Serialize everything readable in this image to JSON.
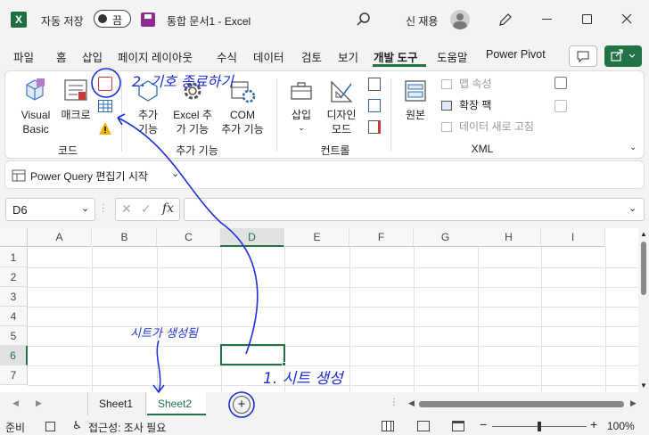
{
  "titlebar": {
    "autosave_label": "자동 저장",
    "autosave_state": "끔",
    "doc_title": "통합 문서1  -  Excel",
    "user_name": "신 재용"
  },
  "tabs": [
    "파일",
    "홈",
    "삽입",
    "페이지 레이아웃",
    "수식",
    "데이터",
    "검토",
    "보기",
    "개발 도구",
    "도움말",
    "Power Pivot"
  ],
  "ribbon": {
    "code": {
      "visual_basic": [
        "Visual",
        "Basic"
      ],
      "macro": "매크로",
      "group": "코드"
    },
    "addins": {
      "addins": [
        "추가",
        "기능"
      ],
      "excel_addins": [
        "Excel 추",
        "가 기능"
      ],
      "com_addins": [
        "COM",
        "추가 기능"
      ],
      "group": "추가 기능"
    },
    "controls": {
      "insert": "삽입",
      "design_mode": [
        "디자인",
        "모드"
      ],
      "group": "컨트롤"
    },
    "xml": {
      "source": "원본",
      "map_properties": "맵 속성",
      "expansion_packs": "확장 팩",
      "refresh_data": "데이터 새로 고침",
      "group": "XML"
    }
  },
  "pq_button": "Power Query 편집기 시작",
  "name_box": "D6",
  "formula_value": "",
  "columns": [
    "A",
    "B",
    "C",
    "D",
    "E",
    "F",
    "G",
    "H",
    "I"
  ],
  "rows": [
    "1",
    "2",
    "3",
    "4",
    "5",
    "6",
    "7"
  ],
  "selected_cell": "D6",
  "sheets": [
    "Sheet1",
    "Sheet2"
  ],
  "active_sheet": "Sheet2",
  "status": {
    "ready": "준비",
    "accessibility": "접근성: 조사 필요",
    "zoom": "100%"
  },
  "annotations": {
    "step1": "1. 시트 생성",
    "step2": "2. 기호 종료하기",
    "note": "시트가 생성됨"
  },
  "colors": {
    "accent": "#217346",
    "ink": "#1a2fd8"
  }
}
